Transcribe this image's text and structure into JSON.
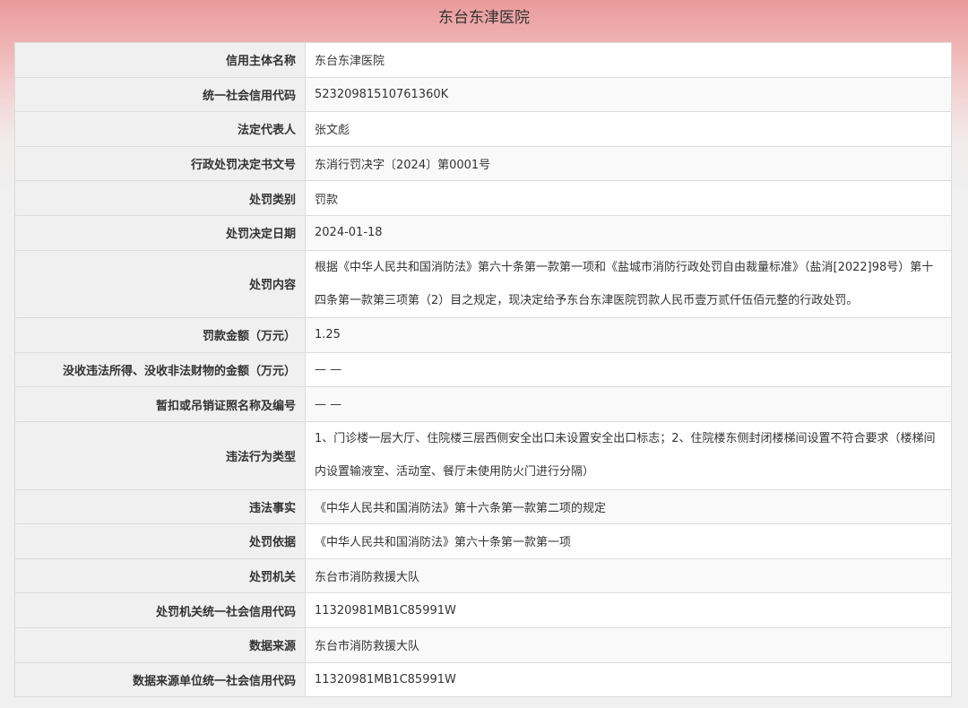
{
  "page": {
    "title": "东台东津医院"
  },
  "rows": [
    {
      "label": "信用主体名称",
      "value": "东台东津医院"
    },
    {
      "label": "统一社会信用代码",
      "value": "52320981510761360K"
    },
    {
      "label": "法定代表人",
      "value": "张文彪"
    },
    {
      "label": "行政处罚决定书文号",
      "value": "东消行罚决字〔2024〕第0001号"
    },
    {
      "label": "处罚类别",
      "value": "罚款"
    },
    {
      "label": "处罚决定日期",
      "value": "2024-01-18"
    },
    {
      "label": "处罚内容",
      "value": "根据《中华人民共和国消防法》第六十条第一款第一项和《盐城市消防行政处罚自由裁量标准》（盐消[2022]98号）第十四条第一款第三项第（2）目之规定，现决定给予东台东津医院罚款人民币壹万贰仟伍佰元整的行政处罚。"
    },
    {
      "label": "罚款金额（万元）",
      "value": "1.25"
    },
    {
      "label": "没收违法所得、没收非法财物的金额（万元）",
      "value": "— —"
    },
    {
      "label": "暂扣或吊销证照名称及编号",
      "value": "— —"
    },
    {
      "label": "违法行为类型",
      "value": "1、门诊楼一层大厅、住院楼三层西侧安全出口未设置安全出口标志；2、住院楼东侧封闭楼梯间设置不符合要求（楼梯间内设置输液室、活动室、餐厅未使用防火门进行分隔）"
    },
    {
      "label": "违法事实",
      "value": "《中华人民共和国消防法》第十六条第一款第二项的规定"
    },
    {
      "label": "处罚依据",
      "value": "《中华人民共和国消防法》第六十条第一款第一项"
    },
    {
      "label": "处罚机关",
      "value": "东台市消防救援大队"
    },
    {
      "label": "处罚机关统一社会信用代码",
      "value": "11320981MB1C85991W"
    },
    {
      "label": "数据来源",
      "value": "东台市消防救援大队"
    },
    {
      "label": "数据来源单位统一社会信用代码",
      "value": "11320981MB1C85991W"
    }
  ]
}
